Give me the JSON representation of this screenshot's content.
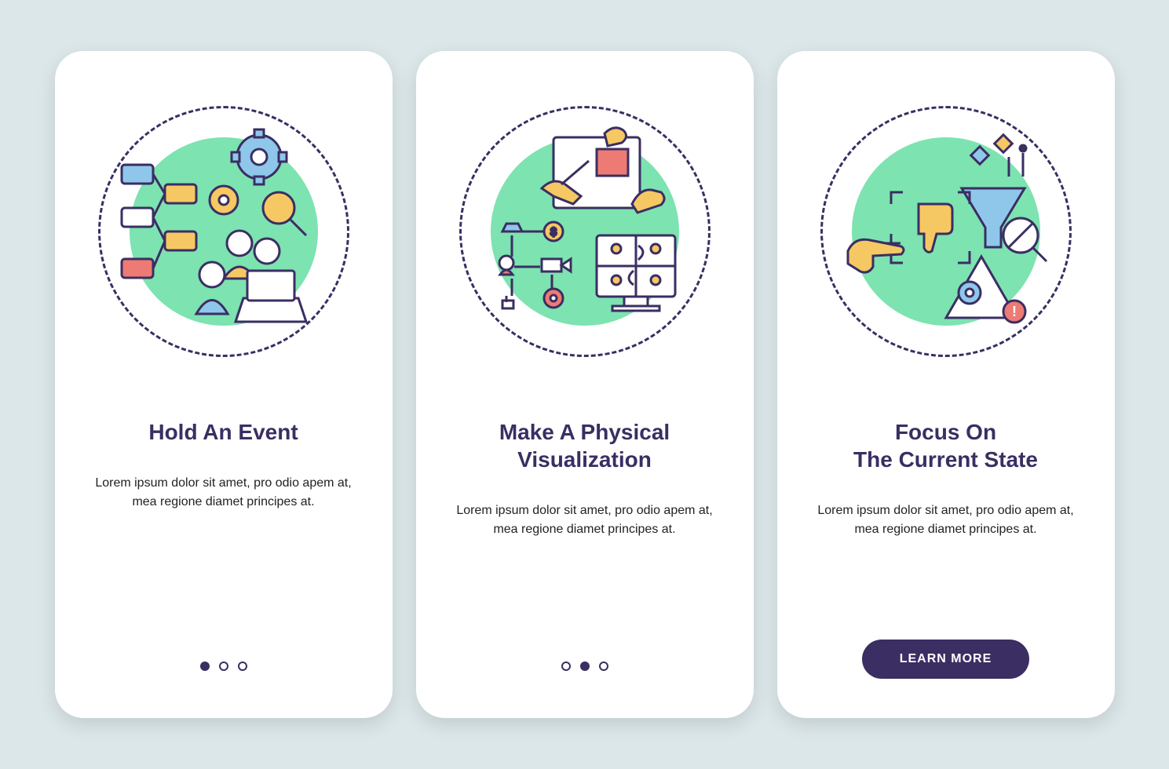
{
  "screens": [
    {
      "title": "Hold An Event",
      "description": "Lorem ipsum dolor sit amet, pro odio apem at, mea regione diamet principes at.",
      "indicator": {
        "count": 3,
        "active": 0,
        "type": "dots"
      }
    },
    {
      "title": "Make A Physical\nVisualization",
      "description": "Lorem ipsum dolor sit amet, pro odio apem at, mea regione diamet principes at.",
      "indicator": {
        "count": 3,
        "active": 1,
        "type": "dots"
      }
    },
    {
      "title": "Focus On\nThe Current State",
      "description": "Lorem ipsum dolor sit amet, pro odio apem at, mea regione diamet principes at.",
      "indicator": {
        "type": "button"
      }
    }
  ],
  "cta_label": "LEARN MORE",
  "colors": {
    "background": "#dce7ea",
    "card": "#ffffff",
    "accent_dark": "#3a2e63",
    "accent_green": "#7de3b0",
    "accent_yellow": "#f5c863",
    "accent_blue": "#8fc7ea",
    "accent_red": "#ed7b74"
  },
  "icons": {
    "screen1": "event-process-icon",
    "screen2": "physical-visualization-icon",
    "screen3": "focus-state-icon"
  }
}
